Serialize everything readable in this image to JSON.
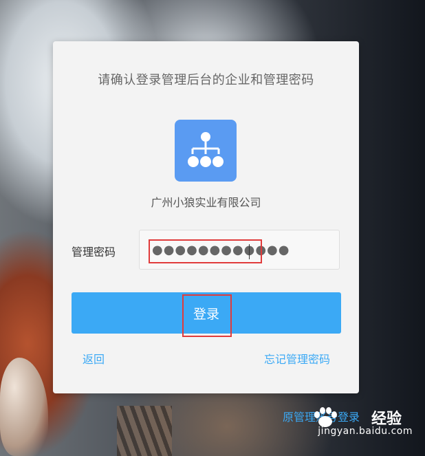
{
  "dialog": {
    "title": "请确认登录管理后台的企业和管理密码",
    "org_icon": "organization-chart-icon",
    "org_name": "广州小狼实业有限公司",
    "password_label": "管理密码",
    "password_value": "●●●●●●●●●●●●",
    "login_label": "登录",
    "back_label": "返回",
    "forgot_label": "忘记管理密码"
  },
  "footer": {
    "admin_account_login": "原管理账号登录"
  },
  "watermark": {
    "brand": "经验",
    "url": "jingyan.baidu.com"
  },
  "colors": {
    "accent": "#3ba9f5",
    "icon_bg": "#5a9bf2",
    "highlight": "#e03b3b",
    "card_bg": "#f3f3f3"
  }
}
